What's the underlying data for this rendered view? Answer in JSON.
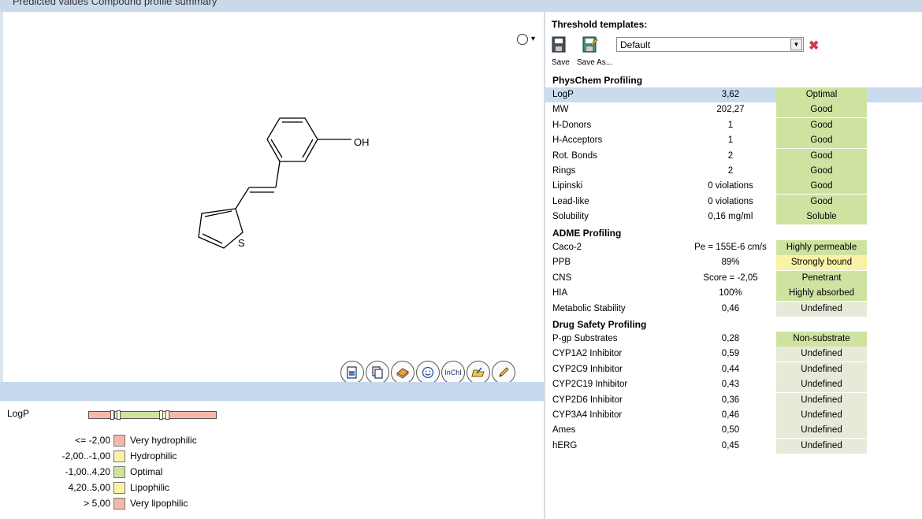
{
  "title_bar": "Predicted values   Compound profile summary",
  "molecule": {
    "atom_oh": "OH",
    "atom_s": "S",
    "view_menu_arrow": "▾"
  },
  "toolbar_icons": [
    "copy-image-icon",
    "copy-icon",
    "book-icon",
    "smiley-icon",
    "inchi-icon",
    "open-folder-icon",
    "pencil-icon"
  ],
  "inchi_label": "InChI",
  "legend": {
    "property": "LogP",
    "rows": [
      {
        "range": "<= -2,00",
        "label": "Very hydrophilic",
        "color": "#f4b8a8"
      },
      {
        "range": "-2,00..-1,00",
        "label": "Hydrophilic",
        "color": "#faf3a6"
      },
      {
        "range": "-1,00..4,20",
        "label": "Optimal",
        "color": "#cfe3a0"
      },
      {
        "range": "4,20..5,00",
        "label": "Lipophilic",
        "color": "#faf3a6"
      },
      {
        "range": "> 5,00",
        "label": "Very lipophilic",
        "color": "#f4b8a8"
      }
    ]
  },
  "threshold": {
    "title": "Threshold templates:",
    "save_label": "Save",
    "save_as_label": "Save As...",
    "selected_template": "Default"
  },
  "sections": {
    "physchem": "PhysChem Profiling",
    "adme": "ADME Profiling",
    "safety": "Drug Safety Profiling"
  },
  "physchem_rows": [
    {
      "name": "LogP",
      "value": "3,62",
      "status": "Optimal",
      "kind": "good"
    },
    {
      "name": "MW",
      "value": "202,27",
      "status": "Good",
      "kind": "good"
    },
    {
      "name": "H-Donors",
      "value": "1",
      "status": "Good",
      "kind": "good"
    },
    {
      "name": "H-Acceptors",
      "value": "1",
      "status": "Good",
      "kind": "good"
    },
    {
      "name": "Rot. Bonds",
      "value": "2",
      "status": "Good",
      "kind": "good"
    },
    {
      "name": "Rings",
      "value": "2",
      "status": "Good",
      "kind": "good"
    },
    {
      "name": "Lipinski",
      "value": "0 violations",
      "status": "Good",
      "kind": "good"
    },
    {
      "name": "Lead-like",
      "value": "0 violations",
      "status": "Good",
      "kind": "good"
    },
    {
      "name": "Solubility",
      "value": "0,16 mg/ml",
      "status": "Soluble",
      "kind": "good"
    }
  ],
  "adme_rows": [
    {
      "name": "Caco-2",
      "value": "Pe = 155E-6 cm/s",
      "status": "Highly permeable",
      "kind": "good"
    },
    {
      "name": "PPB",
      "value": "89%",
      "status": "Strongly bound",
      "kind": "warn"
    },
    {
      "name": "CNS",
      "value": "Score = -2,05",
      "status": "Penetrant",
      "kind": "good"
    },
    {
      "name": "HIA",
      "value": "100%",
      "status": "Highly absorbed",
      "kind": "good"
    },
    {
      "name": "Metabolic Stability",
      "value": "0,46",
      "status": "Undefined",
      "kind": "und"
    }
  ],
  "safety_rows": [
    {
      "name": "P-gp Substrates",
      "value": "0,28",
      "status": "Non-substrate",
      "kind": "good"
    },
    {
      "name": "CYP1A2 Inhibitor",
      "value": "0,59",
      "status": "Undefined",
      "kind": "und"
    },
    {
      "name": "CYP2C9 Inhibitor",
      "value": "0,44",
      "status": "Undefined",
      "kind": "und"
    },
    {
      "name": "CYP2C19 Inhibitor",
      "value": "0,43",
      "status": "Undefined",
      "kind": "und"
    },
    {
      "name": "CYP2D6 Inhibitor",
      "value": "0,36",
      "status": "Undefined",
      "kind": "und"
    },
    {
      "name": "CYP3A4 Inhibitor",
      "value": "0,46",
      "status": "Undefined",
      "kind": "und"
    },
    {
      "name": "Ames",
      "value": "0,50",
      "status": "Undefined",
      "kind": "und"
    },
    {
      "name": "hERG",
      "value": "0,45",
      "status": "Undefined",
      "kind": "und"
    }
  ]
}
